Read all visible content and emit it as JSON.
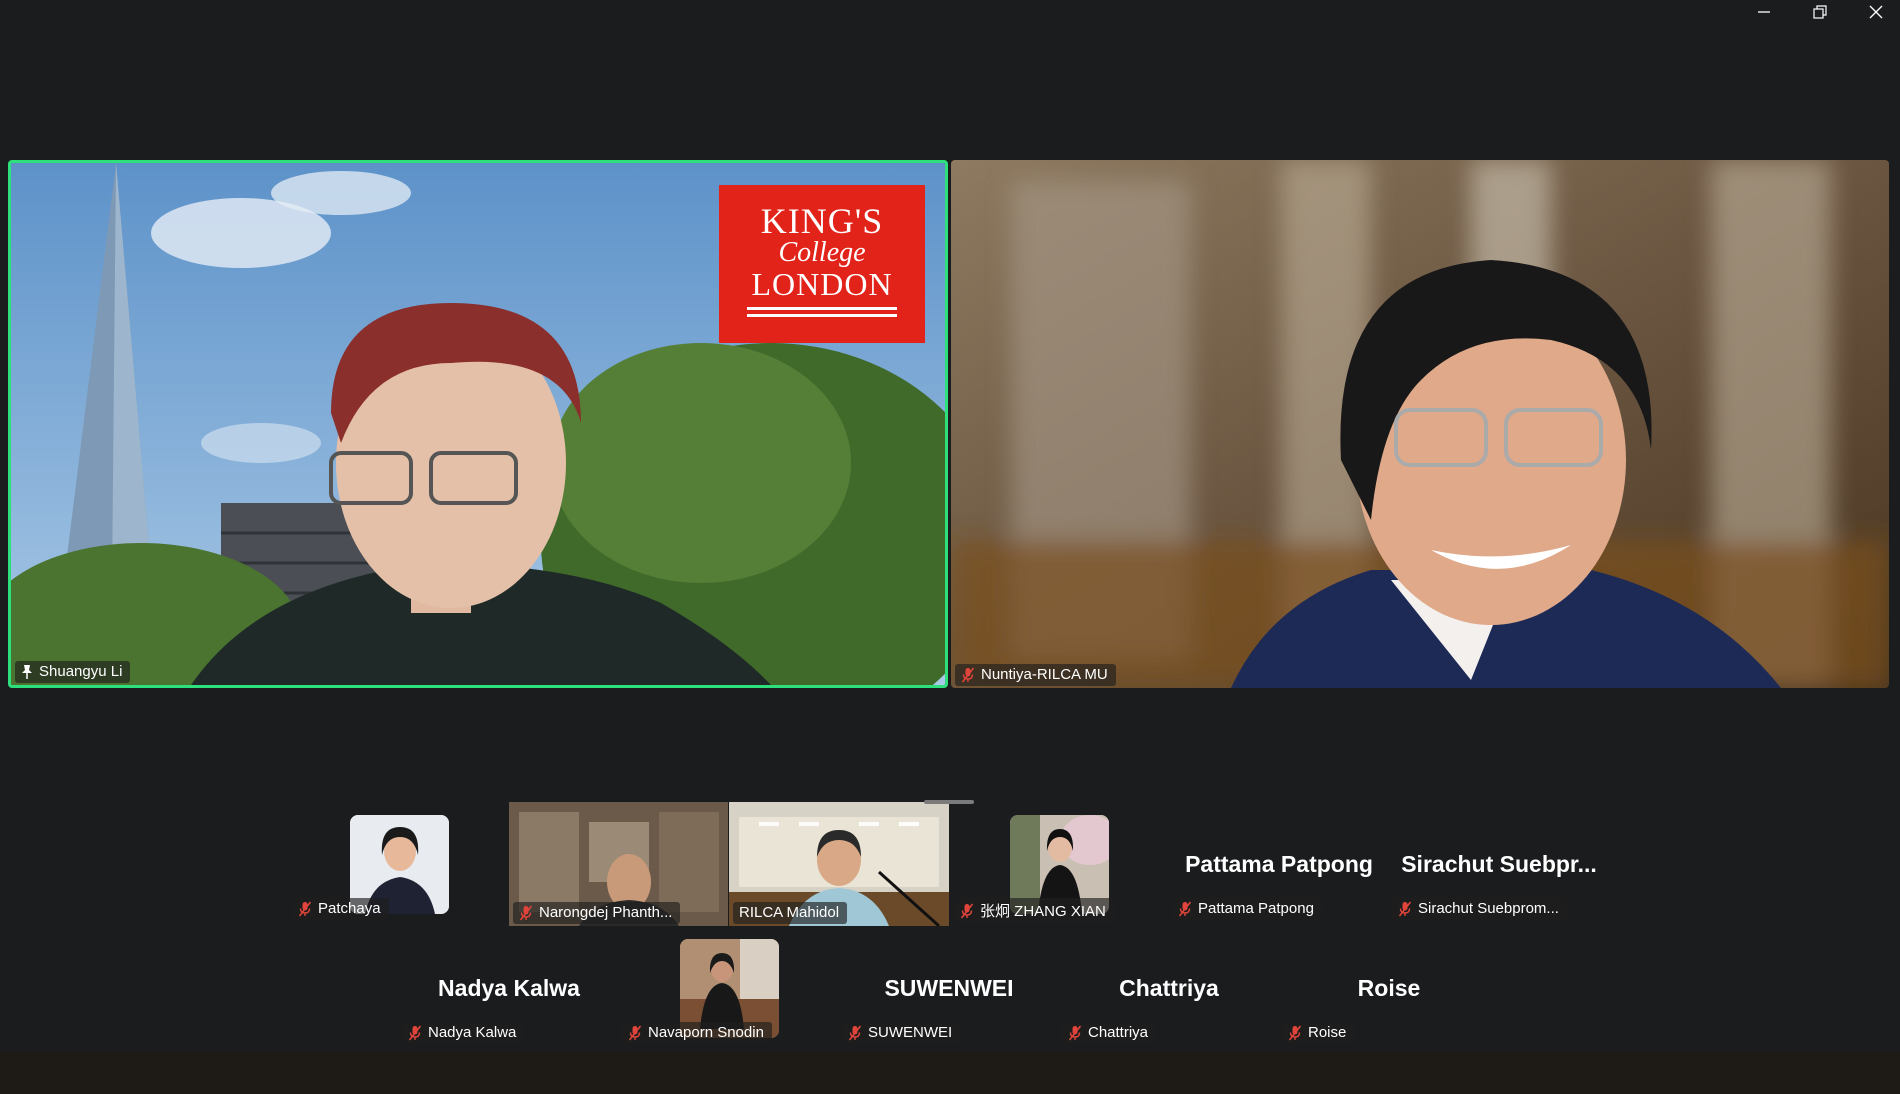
{
  "window": {
    "controls": [
      "minimize",
      "restore",
      "close"
    ]
  },
  "featured": {
    "left": {
      "name": "Shuangyu Li",
      "status": "pinned",
      "logo_lines": [
        "KING'S",
        "College",
        "LONDON"
      ]
    },
    "right": {
      "name": "Nuntiya-RILCA MU",
      "status": "muted"
    }
  },
  "gallery": {
    "row1": [
      {
        "name": "Patchaya",
        "type": "video"
      },
      {
        "name": "Narongdej Phanth...",
        "type": "video"
      },
      {
        "name": "RILCA Mahidol",
        "type": "video"
      },
      {
        "name": "张炯 ZHANG XIAN",
        "type": "video"
      },
      {
        "name": "Pattama Patpong",
        "title": "Pattama Patpong",
        "type": "name"
      },
      {
        "name": "Sirachut Suebprom...",
        "title": "Sirachut  Suebpr...",
        "type": "name"
      }
    ],
    "row2": [
      {
        "name": "Nadya Kalwa",
        "title": "Nadya Kalwa",
        "type": "name"
      },
      {
        "name": "Navaporn Snodin",
        "type": "video"
      },
      {
        "name": "SUWENWEI",
        "title": "SUWENWEI",
        "type": "name"
      },
      {
        "name": "Chattriya",
        "title": "Chattriya",
        "type": "name"
      },
      {
        "name": "Roise",
        "title": "Roise",
        "type": "name"
      }
    ]
  },
  "colors": {
    "active_speaker_border": "#2ee07c",
    "mic_muted": "#e0443a",
    "kcl_red": "#e2231a",
    "background": "#1a1c1e"
  }
}
